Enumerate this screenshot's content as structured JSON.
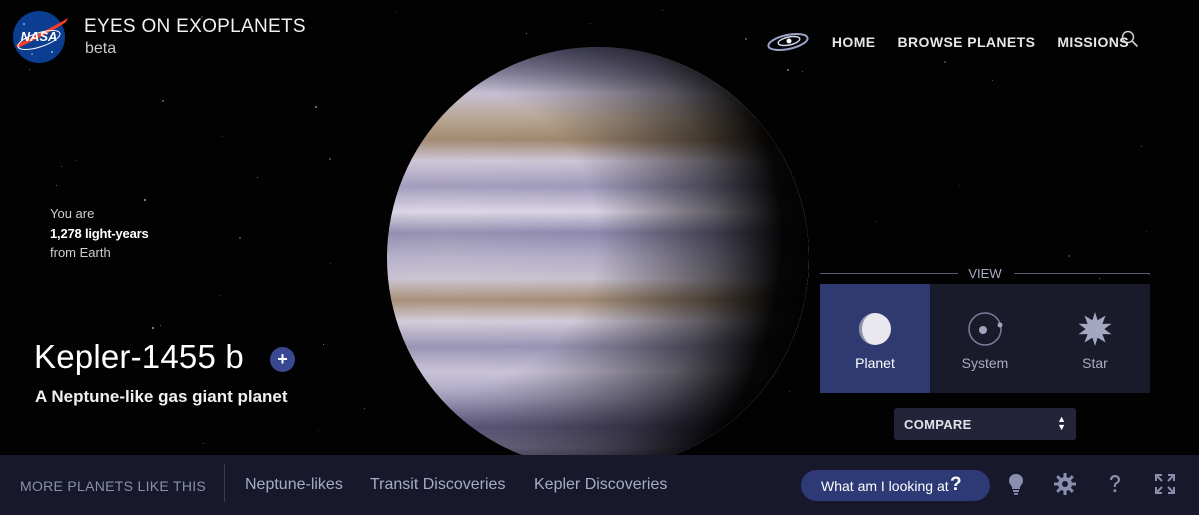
{
  "header": {
    "logo_text": "NASA",
    "title": "EYES ON EXOPLANETS",
    "subtitle": "beta",
    "nav": [
      "HOME",
      "BROWSE PLANETS",
      "MISSIONS"
    ],
    "icons": [
      "galaxy-icon",
      "search-icon"
    ]
  },
  "distance": {
    "line1": "You are",
    "value": "1,278 light-years",
    "line3": "from Earth"
  },
  "planet": {
    "name": "Kepler-1455 b",
    "add_label": "+",
    "description": "A Neptune-like gas giant planet"
  },
  "view": {
    "label": "VIEW",
    "buttons": [
      {
        "label": "Planet",
        "icon": "planet-icon",
        "active": true
      },
      {
        "label": "System",
        "icon": "system-icon",
        "active": false
      },
      {
        "label": "Star",
        "icon": "star-icon",
        "active": false
      }
    ],
    "compare_label": "COMPARE"
  },
  "footer": {
    "more_label": "MORE PLANETS LIKE THIS",
    "links": [
      "Neptune-likes",
      "Transit Discoveries",
      "Kepler Discoveries"
    ],
    "what_label": "What am I looking at",
    "what_q": "?",
    "icons": [
      "lightbulb-icon",
      "gear-icon",
      "help-icon",
      "fullscreen-icon"
    ]
  },
  "colors": {
    "accent": "#2e3a70",
    "footer_bg": "#17182c",
    "panel_bg": "#191a2a"
  }
}
